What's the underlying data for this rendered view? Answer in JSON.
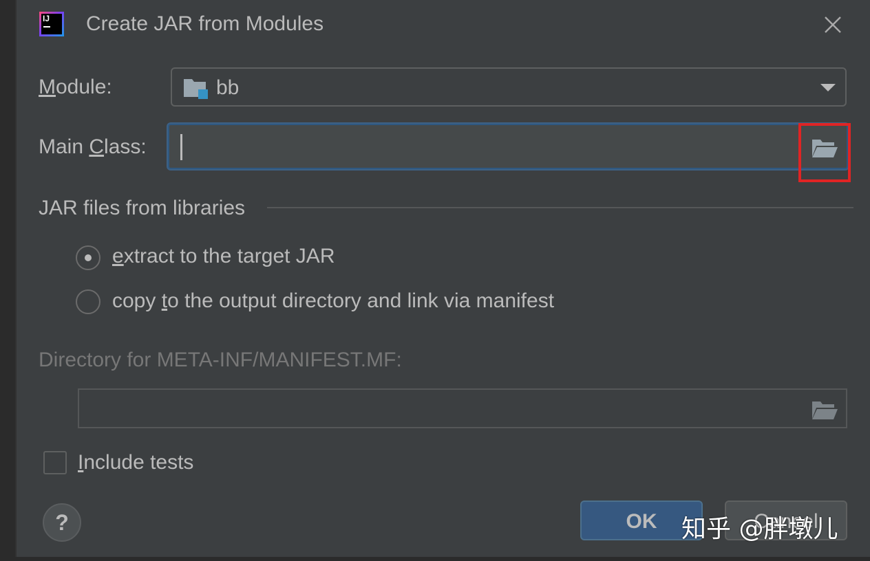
{
  "dialog": {
    "title": "Create JAR from Modules"
  },
  "module": {
    "label_mnemonic": "M",
    "label_rest": "odule:",
    "value": "bb"
  },
  "main_class": {
    "label_pre": "Main ",
    "label_mnemonic": "C",
    "label_post": "lass:",
    "value": ""
  },
  "libraries": {
    "section_title": "JAR files from libraries",
    "options": [
      {
        "mnemonic": "e",
        "rest": "xtract to the target JAR",
        "selected": true
      },
      {
        "pre": "copy ",
        "mnemonic": "t",
        "rest": "o the output directory and link via manifest",
        "selected": false
      }
    ]
  },
  "manifest": {
    "label": "Directory for META-INF/MANIFEST.MF:",
    "value": "",
    "enabled": false
  },
  "include_tests": {
    "mnemonic": "I",
    "rest": "nclude tests",
    "checked": false
  },
  "buttons": {
    "help": "?",
    "ok": "OK",
    "cancel": "Cancel"
  },
  "watermark": "知乎 @胖墩儿",
  "colors": {
    "background": "#3c3f41",
    "text": "#bbbbbb",
    "focus_border": "#3d6185",
    "primary_button": "#365880",
    "highlight": "#e02424",
    "folder_accent": "#3592c4"
  },
  "icons": {
    "app": "intellij-idea-logo",
    "close": "close-icon",
    "module": "module-folder-icon",
    "browse": "folder-open-icon",
    "dropdown": "chevron-down-icon",
    "help": "help-icon"
  }
}
